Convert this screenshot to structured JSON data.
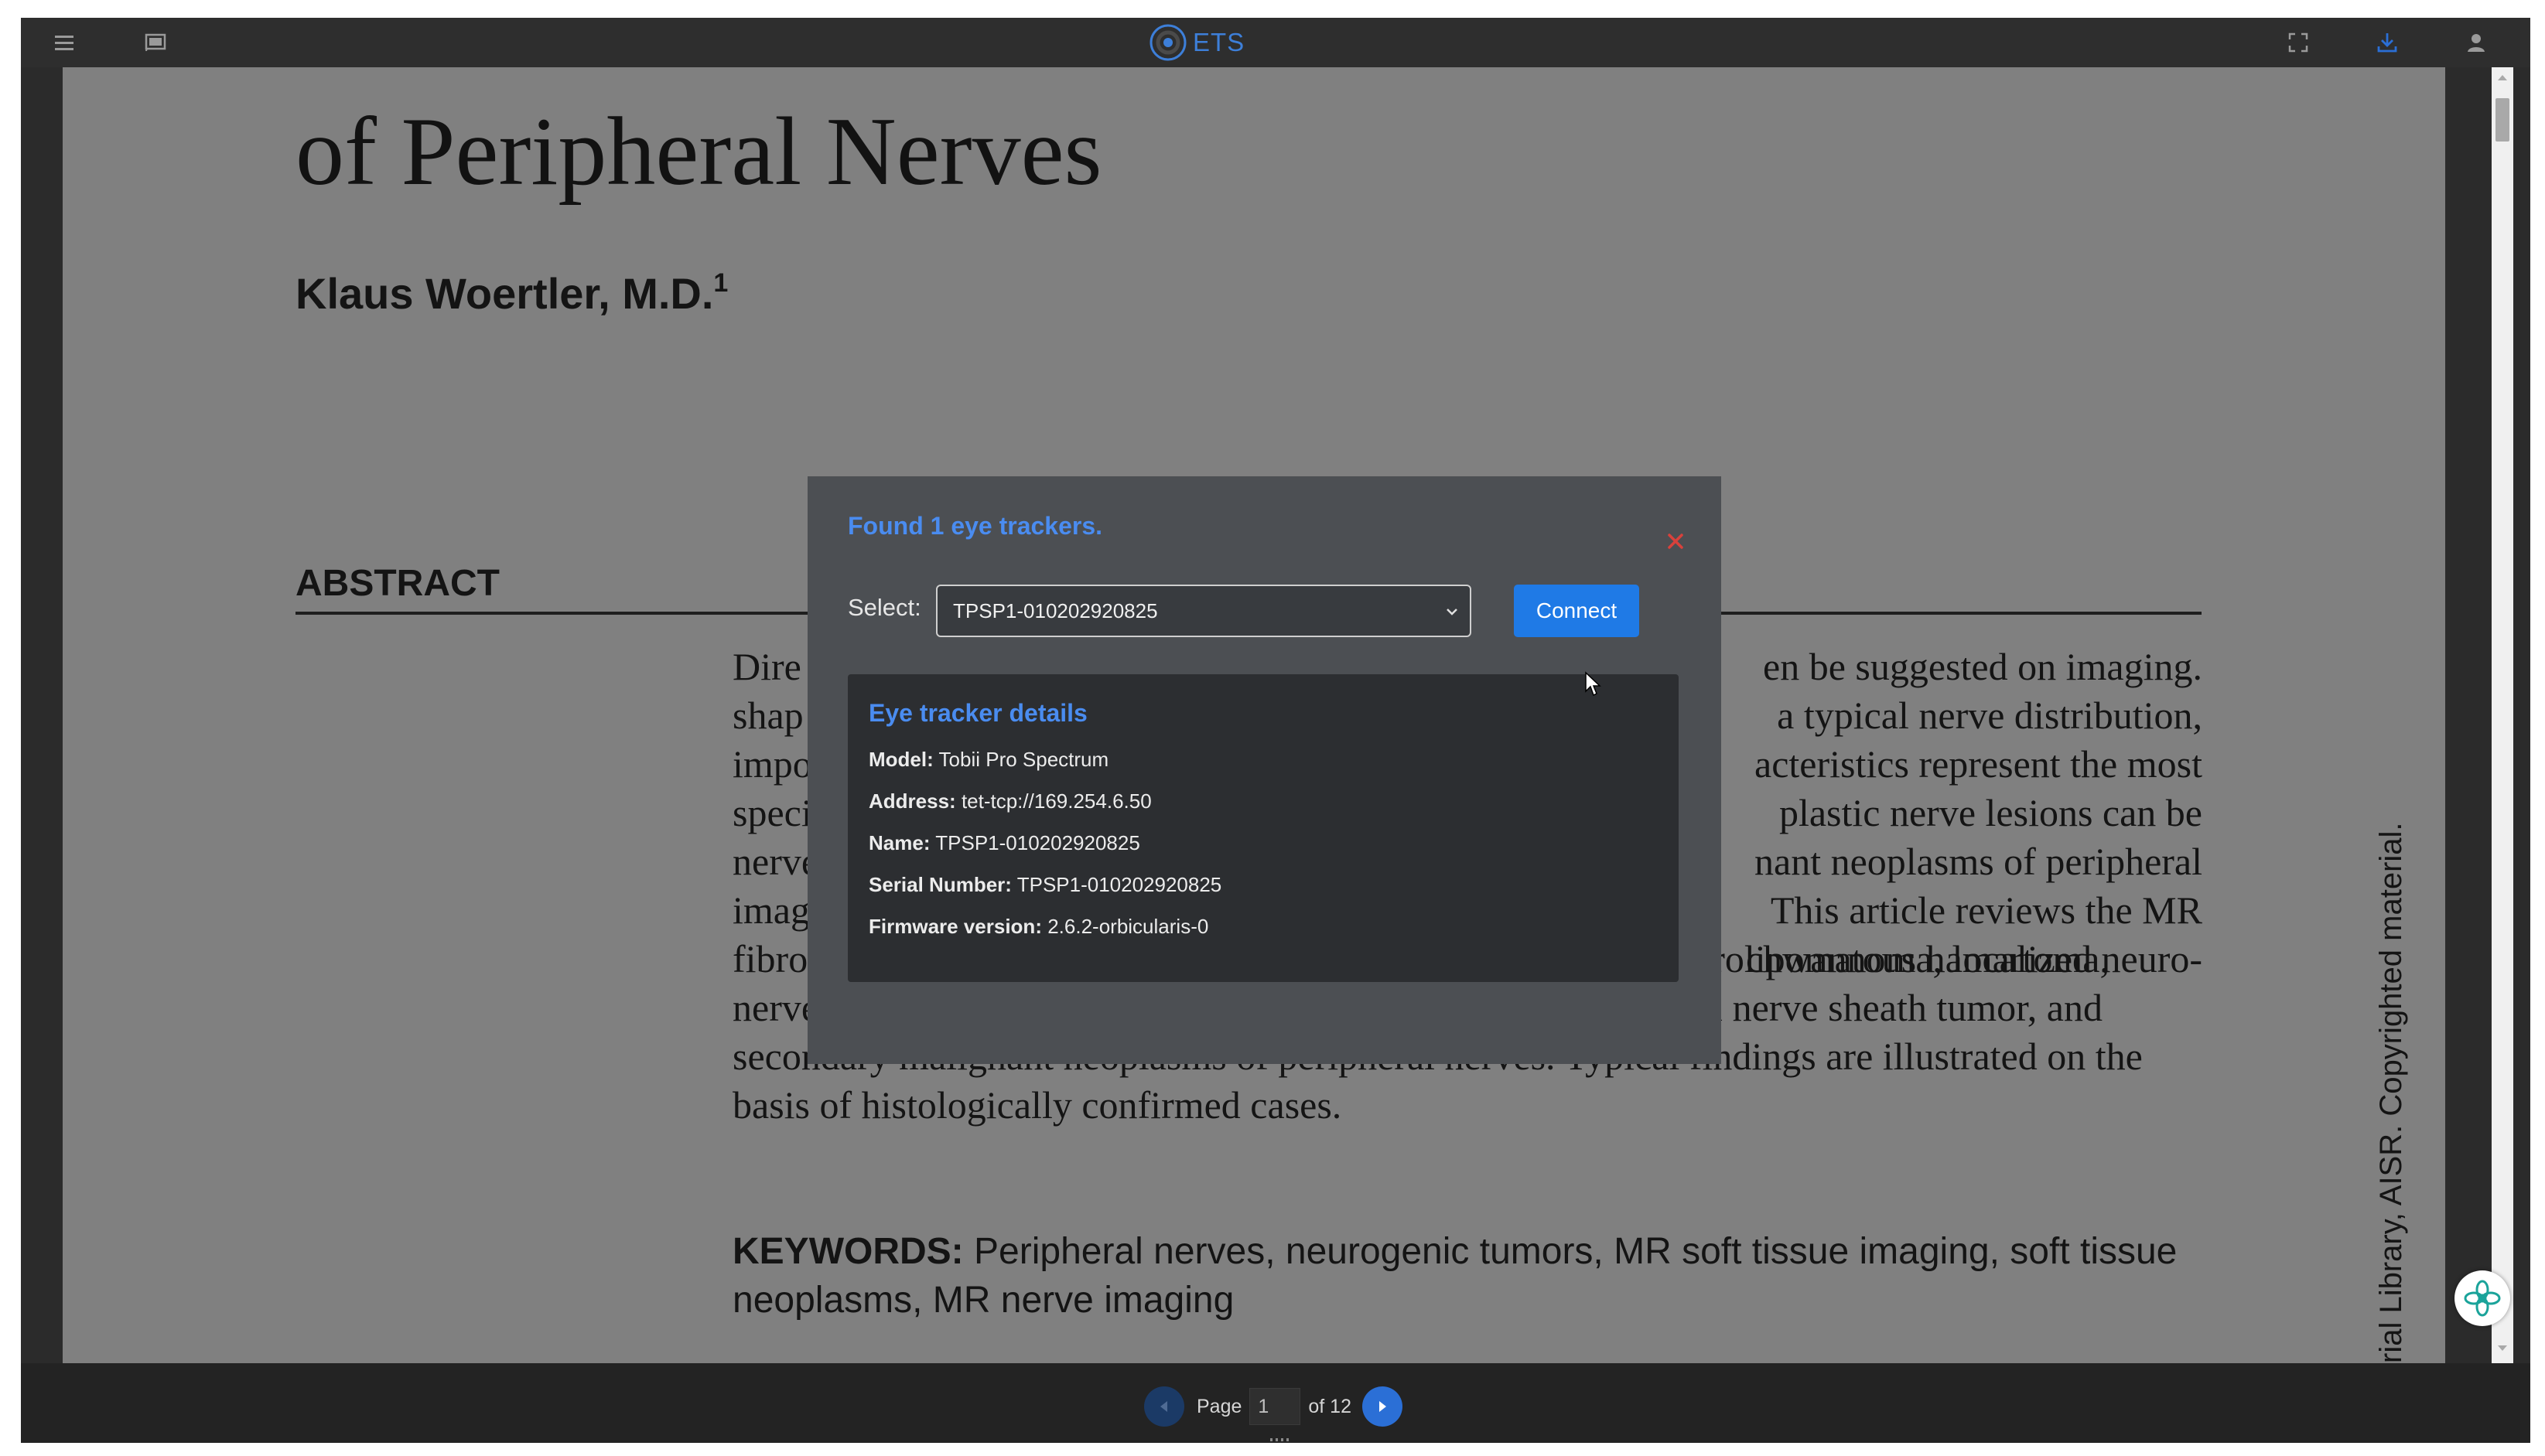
{
  "topbar": {
    "menu_icon": "hamburger-menu-icon",
    "cast_icon": "cast-icon",
    "logo_text": "ETS",
    "fullscreen_icon": "fullscreen-icon",
    "download_icon": "download-icon",
    "user_icon": "user-icon",
    "accent": "#3d7fd9"
  },
  "document": {
    "title": "of Peripheral Nerves",
    "author": "Klaus Woertler, M.D.",
    "author_sup": "1",
    "abstract_heading": "ABSTRACT",
    "abstract_lines": [
      "Dire",
      "shap",
      "impo",
      "speci",
      "nerve",
      "imag",
      "fibroma, plexiform neurofibroma, intraneural perineurioma, fibrolipomatous hamartoma,",
      "nerve sheath ganglion, traumatic neuroma, malignant peripheral nerve sheath tumor, and",
      "secondary malignant neoplasms of peripheral nerves. Typical findings are illustrated on the",
      "basis of histologically confirmed cases."
    ],
    "abstract_right_fragments": [
      "en be suggested on imaging.",
      "a typical nerve distribution,",
      "acteristics represent the most",
      "plastic nerve lesions can be",
      "nant neoplasms of peripheral",
      "This article reviews the MR",
      "chwannoma, localized neuro-"
    ],
    "keywords_label": "KEYWORDS:",
    "keywords_text": "Peripheral nerves, neurogenic tumors, MR soft tissue imaging, soft tissue neoplasms, MR nerve imaging",
    "side_note": "rial Library, AISR. Copyrighted material."
  },
  "modal": {
    "title": "Found 1 eye trackers.",
    "close_icon": "close-icon",
    "select_label": "Select:",
    "select_value": "TPSP1-010202920825",
    "connect_label": "Connect",
    "details_title": "Eye tracker details",
    "details": [
      {
        "key": "Model:",
        "value": "Tobii Pro Spectrum"
      },
      {
        "key": "Address:",
        "value": "tet-tcp://169.254.6.50"
      },
      {
        "key": "Name:",
        "value": "TPSP1-010202920825"
      },
      {
        "key": "Serial Number:",
        "value": "TPSP1-010202920825"
      },
      {
        "key": "Firmware version:",
        "value": "2.6.2-orbicularis-0"
      }
    ],
    "accent": "#4a8cf0",
    "button_color": "#1f7ae6",
    "close_color": "#d9413b"
  },
  "pager": {
    "page_label": "Page",
    "current_page": "1",
    "of_label": "of 12"
  },
  "assistant_icon": "assistant-flower-icon"
}
